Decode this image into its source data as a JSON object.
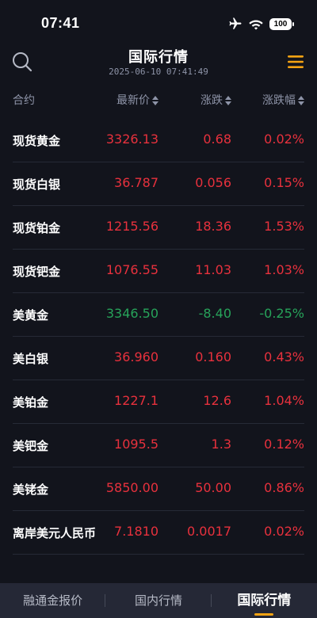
{
  "status_bar": {
    "time": "07:41",
    "battery": "100",
    "icons": [
      "airplane-icon",
      "wifi-icon",
      "battery-icon"
    ]
  },
  "header": {
    "title": "国际行情",
    "subtitle": "2025-06-10 07:41:49",
    "icons": [
      "search-icon",
      "menu-icon"
    ],
    "accent_color": "#f5a313"
  },
  "columns": {
    "name": "合约",
    "price": "最新价",
    "change": "涨跌",
    "pct": "涨跌幅"
  },
  "colors": {
    "up": "#e8313d",
    "down": "#27a35a"
  },
  "rows": [
    {
      "name": "现货黄金",
      "price": "3326.13",
      "change": "0.68",
      "pct": "0.02%",
      "dir": "up"
    },
    {
      "name": "现货白银",
      "price": "36.787",
      "change": "0.056",
      "pct": "0.15%",
      "dir": "up"
    },
    {
      "name": "现货铂金",
      "price": "1215.56",
      "change": "18.36",
      "pct": "1.53%",
      "dir": "up"
    },
    {
      "name": "现货钯金",
      "price": "1076.55",
      "change": "11.03",
      "pct": "1.03%",
      "dir": "up"
    },
    {
      "name": "美黄金",
      "price": "3346.50",
      "change": "-8.40",
      "pct": "-0.25%",
      "dir": "down"
    },
    {
      "name": "美白银",
      "price": "36.960",
      "change": "0.160",
      "pct": "0.43%",
      "dir": "up"
    },
    {
      "name": "美铂金",
      "price": "1227.1",
      "change": "12.6",
      "pct": "1.04%",
      "dir": "up"
    },
    {
      "name": "美钯金",
      "price": "1095.5",
      "change": "1.3",
      "pct": "0.12%",
      "dir": "up"
    },
    {
      "name": "美铑金",
      "price": "5850.00",
      "change": "50.00",
      "pct": "0.86%",
      "dir": "up"
    },
    {
      "name": "离岸美元人民币",
      "price": "7.1810",
      "change": "0.0017",
      "pct": "0.02%",
      "dir": "up"
    }
  ],
  "tabs": [
    {
      "label": "融通金报价",
      "active": false
    },
    {
      "label": "国内行情",
      "active": false
    },
    {
      "label": "国际行情",
      "active": true
    }
  ]
}
